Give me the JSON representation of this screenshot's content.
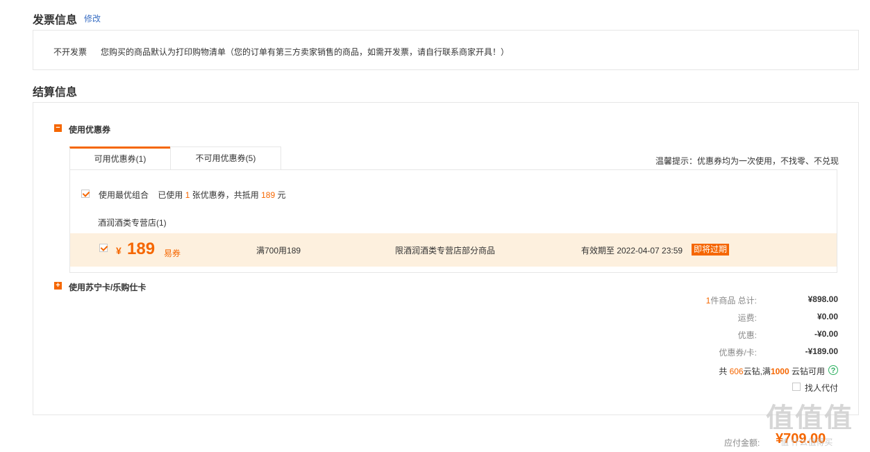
{
  "invoice": {
    "title": "发票信息",
    "edit_link": "修改",
    "type": "不开发票",
    "note": "您购买的商品默认为打印购物清单（您的订单有第三方卖家销售的商品，如需开发票，请自行联系商家开具！）"
  },
  "settlement": {
    "title": "结算信息",
    "coupon_section": {
      "toggle_icon": "minus",
      "label": "使用优惠券",
      "tabs": [
        {
          "label": "可用优惠券(1)",
          "active": true
        },
        {
          "label": "不可用优惠券(5)",
          "active": false
        }
      ],
      "tip": "温馨提示：优惠券均为一次使用，不找零、不兑现",
      "best_combo": {
        "checked": true,
        "label": "使用最优组合",
        "used_prefix": "已使用",
        "used_count": "1",
        "used_mid": "张优惠券，共抵用",
        "used_amount": "189",
        "used_suffix": "元"
      },
      "store_name": "酒润酒类专营店(1)",
      "coupon": {
        "checked": true,
        "currency": "¥",
        "amount": "189",
        "type": "易券",
        "condition": "满700用189",
        "scope": "限酒润酒类专营店部分商品",
        "expiry": "有效期至 2022-04-07 23:59",
        "badge": "即将过期"
      }
    },
    "card_section": {
      "toggle_icon": "plus",
      "label": "使用苏宁卡/乐购仕卡"
    },
    "summary": {
      "items_count": "1",
      "items_label": "件商品 总计:",
      "total": "¥898.00",
      "shipping_label": "运费:",
      "shipping": "¥0.00",
      "discount_label": "优惠:",
      "discount": "-¥0.00",
      "coupon_label": "优惠券/卡:",
      "coupon": "-¥189.00",
      "diamond_prefix": "共",
      "diamond_count": "606",
      "diamond_mid": "云钻,满",
      "diamond_threshold": "1000",
      "diamond_suffix": "云钻可用",
      "proxy_pay_label": "找人代付",
      "proxy_pay_checked": false
    },
    "payable_label": "应付金额:",
    "payable_amount": "¥709.00",
    "watermark": "值 什么值得买"
  },
  "colors": {
    "accent": "#f56600",
    "link": "#3a6fc4",
    "highlight_bg": "#fdf0de",
    "help": "#2cb060"
  }
}
